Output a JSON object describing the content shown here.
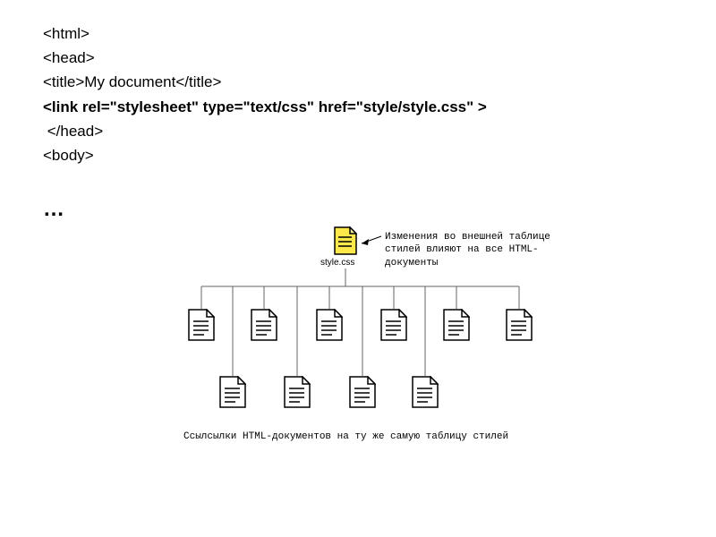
{
  "code": {
    "line1": "<html>",
    "line2": "<head>",
    "line3": "<title>My document</title>",
    "line4": "<link rel=\"stylesheet\" type=\"text/css\" href=\"style/style.css\" >",
    "line5": " </head>",
    "line6": "<body>"
  },
  "ellipsis": "…",
  "css_file_label": "style.css",
  "annotation": "Изменения во внешней таблице\nстилей влияют на все HTML-\nдокументы",
  "caption": "Ссылсылки HTML-документов на ту же самую таблицу стилей"
}
